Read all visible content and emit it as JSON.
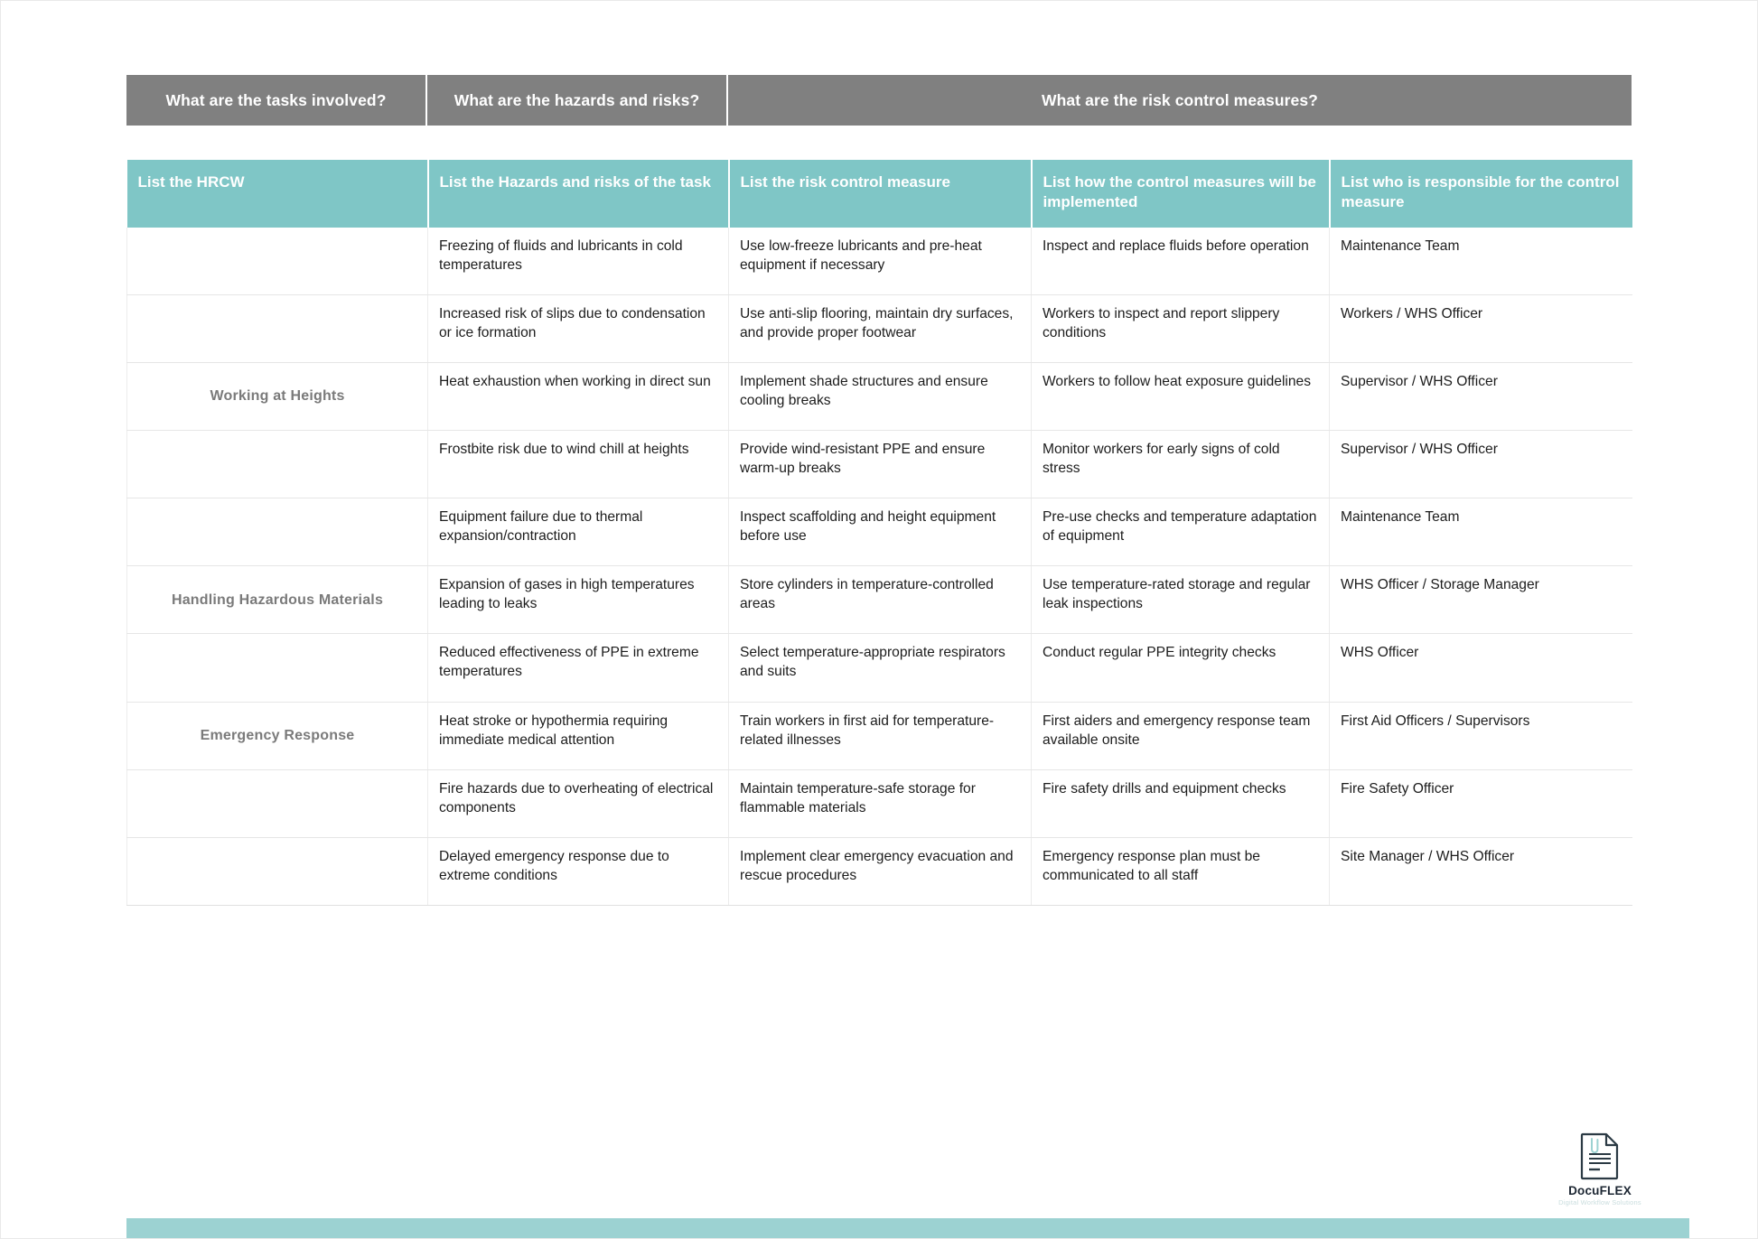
{
  "document": {
    "logo": {
      "name": "DocuFLEX",
      "tagline": "Digital Workflow Solutions",
      "icon": "document-icon"
    },
    "accent_color": "#7fc6c6",
    "header_color": "#808080",
    "footer_band_color": "#9cd2d2"
  },
  "group_headers": [
    {
      "label": "What are the tasks involved?"
    },
    {
      "label": "What are the hazards and risks?"
    },
    {
      "label": "What are the risk control measures?"
    }
  ],
  "table": {
    "columns": [
      {
        "key": "hrcw",
        "label": "List the HRCW"
      },
      {
        "key": "hazard",
        "label": "List the Hazards and risks of the task"
      },
      {
        "key": "control",
        "label": "List the risk control measure"
      },
      {
        "key": "implementation",
        "label": "List how the control measures will be implemented"
      },
      {
        "key": "responsible",
        "label": "List who is responsible for the control measure"
      }
    ],
    "rows": [
      {
        "hrcw": "",
        "hazard": "Freezing of fluids and lubricants in cold temperatures",
        "control": "Use low-freeze lubricants and pre-heat equipment if necessary",
        "implementation": "Inspect and replace fluids before operation",
        "responsible": "Maintenance Team"
      },
      {
        "hrcw": "",
        "hazard": "Increased risk of slips due to condensation or ice formation",
        "control": "Use anti-slip flooring, maintain dry surfaces, and provide proper footwear",
        "implementation": "Workers to inspect and report slippery conditions",
        "responsible": "Workers / WHS Officer"
      },
      {
        "hrcw": "Working at Heights",
        "hazard": "Heat exhaustion when working in direct sun",
        "control": "Implement shade structures and ensure cooling breaks",
        "implementation": "Workers to follow heat exposure guidelines",
        "responsible": "Supervisor / WHS Officer"
      },
      {
        "hrcw": "",
        "hazard": "Frostbite risk due to wind chill at heights",
        "control": "Provide wind-resistant PPE and ensure warm-up breaks",
        "implementation": "Monitor workers for early signs of cold stress",
        "responsible": "Supervisor / WHS Officer"
      },
      {
        "hrcw": "",
        "hazard": "Equipment failure due to thermal expansion/contraction",
        "control": "Inspect scaffolding and height equipment before use",
        "implementation": "Pre-use checks and temperature adaptation of equipment",
        "responsible": "Maintenance Team"
      },
      {
        "hrcw": "Handling Hazardous Materials",
        "hazard": "Expansion of gases in high temperatures leading to leaks",
        "control": "Store cylinders in temperature-controlled areas",
        "implementation": "Use temperature-rated storage and regular leak inspections",
        "responsible": "WHS Officer / Storage Manager"
      },
      {
        "hrcw": "",
        "hazard": "Reduced effectiveness of PPE in extreme temperatures",
        "control": "Select temperature-appropriate respirators and suits",
        "implementation": "Conduct regular PPE integrity checks",
        "responsible": "WHS Officer"
      },
      {
        "hrcw": "Emergency Response",
        "hazard": "Heat stroke or hypothermia requiring immediate medical attention",
        "control": "Train workers in first aid for temperature-related illnesses",
        "implementation": "First aiders and emergency response team available onsite",
        "responsible": "First Aid Officers / Supervisors"
      },
      {
        "hrcw": "",
        "hazard": "Fire hazards due to overheating of electrical components",
        "control": "Maintain temperature-safe storage for flammable materials",
        "implementation": "Fire safety drills and equipment checks",
        "responsible": "Fire Safety Officer"
      },
      {
        "hrcw": "",
        "hazard": "Delayed emergency response due to extreme conditions",
        "control": "Implement clear emergency evacuation and rescue procedures",
        "implementation": "Emergency response plan must be communicated to all staff",
        "responsible": "Site Manager / WHS Officer"
      }
    ]
  }
}
